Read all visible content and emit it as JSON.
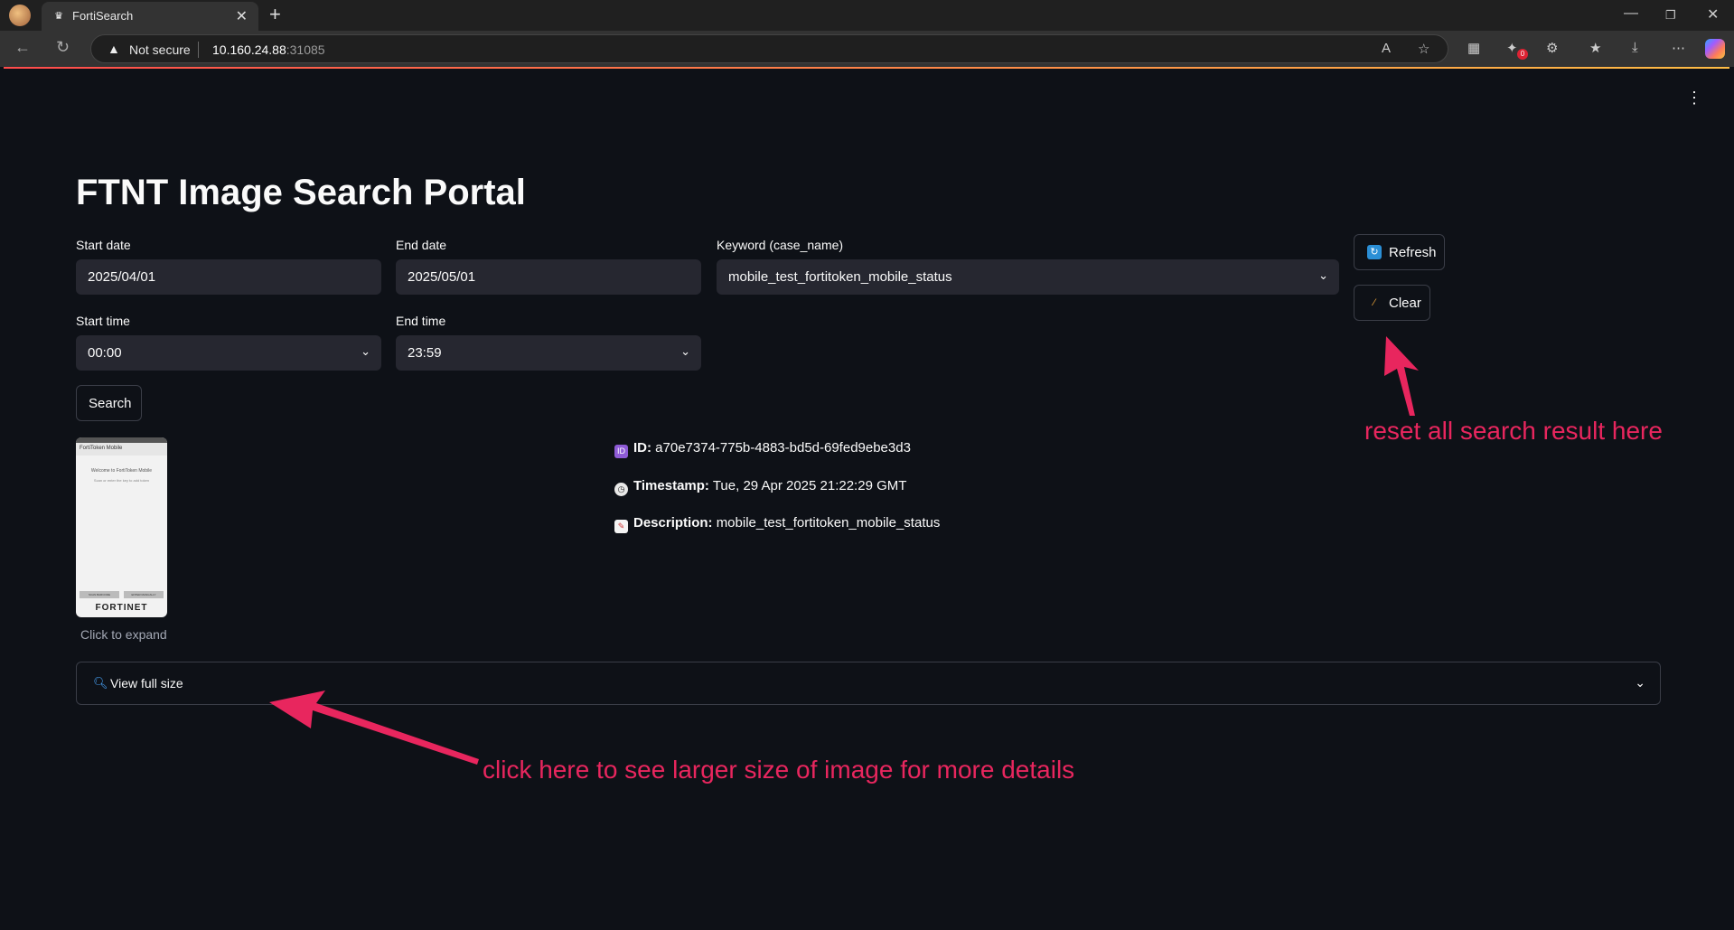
{
  "browser": {
    "tab_title": "FortiSearch",
    "tab_close": "✕",
    "new_tab": "+",
    "security_label": "Not secure",
    "url_host": "10.160.24.88",
    "url_port": ":31085",
    "download_badge": "0"
  },
  "app": {
    "title": "FTNT Image Search Portal",
    "start_date": {
      "label": "Start date",
      "value": "2025/04/01"
    },
    "end_date": {
      "label": "End date",
      "value": "2025/05/01"
    },
    "keyword": {
      "label": "Keyword (case_name)",
      "value": "mobile_test_fortitoken_mobile_status"
    },
    "start_time": {
      "label": "Start time",
      "value": "00:00"
    },
    "end_time": {
      "label": "End time",
      "value": "23:59"
    },
    "search_button": "Search",
    "refresh_button": "Refresh",
    "clear_button": "Clear",
    "thumbnail": {
      "header": "FortiToken Mobile",
      "welcome": "Welcome to FortiToken Mobile",
      "subtext": "Scan or enter the key to add token",
      "scan_button": "SCAN BARCODE",
      "enter_button": "ENTER MANUALLY",
      "logo": "FORTINET",
      "caption": "Click to expand"
    },
    "details": {
      "id_label": "ID:",
      "id_value": "a70e7374-775b-4883-bd5d-69fed9ebe3d3",
      "timestamp_label": "Timestamp:",
      "timestamp_value": "Tue, 29 Apr 2025 21:22:29 GMT",
      "description_label": "Description:",
      "description_value": "mobile_test_fortitoken_mobile_status"
    },
    "expander_label": "View full size"
  },
  "annotations": {
    "reset_note": "reset all search result here",
    "expand_note": "click here to see larger size of image for more details",
    "color": "#e8265e"
  }
}
